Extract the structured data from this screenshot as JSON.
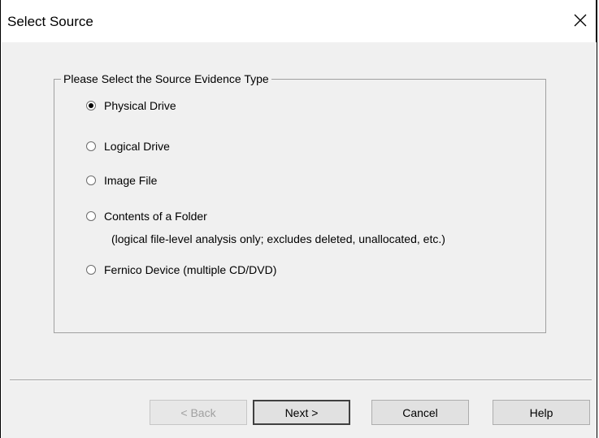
{
  "window": {
    "title": "Select Source"
  },
  "group": {
    "legend": "Please Select the Source Evidence Type",
    "options": [
      {
        "label": "Physical Drive",
        "checked": true
      },
      {
        "label": "Logical Drive",
        "checked": false
      },
      {
        "label": "Image File",
        "checked": false
      },
      {
        "label": "Contents of a Folder",
        "checked": false
      },
      {
        "label": "Fernico Device (multiple CD/DVD)",
        "checked": false
      }
    ],
    "folder_note": "(logical file-level analysis only; excludes deleted, unallocated, etc.)"
  },
  "buttons": {
    "back": "< Back",
    "next": "Next >",
    "cancel": "Cancel",
    "help": "Help"
  }
}
